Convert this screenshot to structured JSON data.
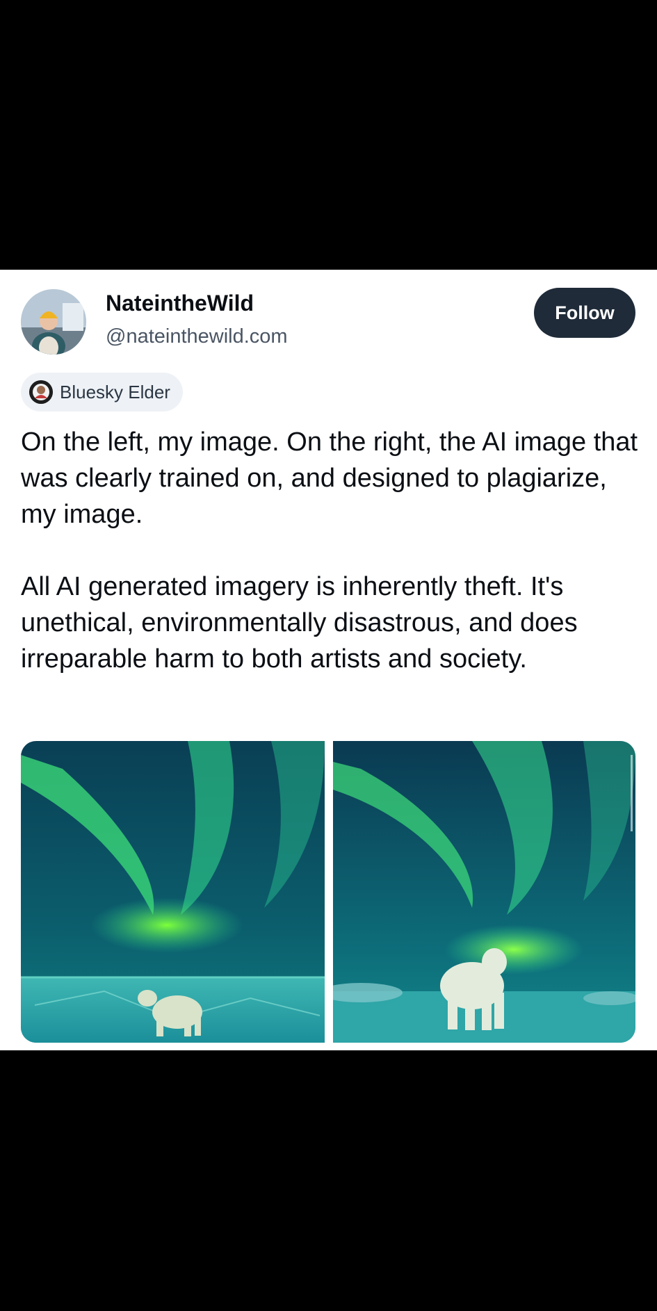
{
  "post": {
    "author": {
      "display_name": "NateintheWild",
      "handle": "@nateinthewild.com",
      "avatar_icon": "profile-photo"
    },
    "follow_label": "Follow",
    "badge": {
      "icon": "bluesky-elder-icon",
      "label": "Bluesky Elder"
    },
    "paragraphs": [
      "On the left, my image. On the right, the AI image that was clearly trained on, and designed to plagiarize, my image.",
      "All AI generated imagery is inherently theft. It's unethical, environmentally disastrous, and does irreparable harm to both artists and society."
    ],
    "images": [
      {
        "icon": "aurora-polar-bear-photo"
      },
      {
        "icon": "aurora-polar-bear-ai-image"
      }
    ]
  },
  "colors": {
    "page_background": "#000000",
    "card_background": "#ffffff",
    "follow_button": "#1f2b38",
    "aurora_green": "#3ee07a",
    "sky_teal": "#0d6e7a"
  }
}
